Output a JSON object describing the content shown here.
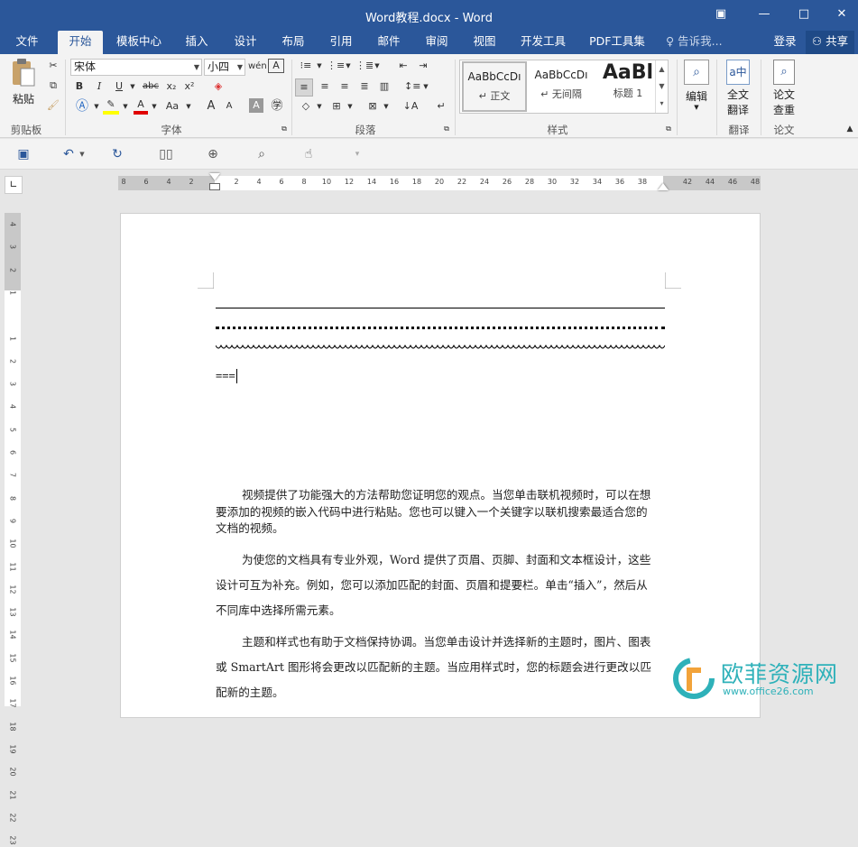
{
  "title": "Word教程.docx - Word",
  "window_buttons": {
    "restore_ribbon": "▣",
    "minimize": "—",
    "maximize": "□",
    "close": "✕"
  },
  "tabs": [
    {
      "label": "文件"
    },
    {
      "label": "开始"
    },
    {
      "label": "模板中心"
    },
    {
      "label": "插入"
    },
    {
      "label": "设计"
    },
    {
      "label": "布局"
    },
    {
      "label": "引用"
    },
    {
      "label": "邮件"
    },
    {
      "label": "审阅"
    },
    {
      "label": "视图"
    },
    {
      "label": "开发工具"
    },
    {
      "label": "PDF工具集"
    }
  ],
  "tell_me": "告诉我...",
  "login": "登录",
  "share": "共享",
  "ribbon": {
    "clipboard": {
      "paste": "粘贴",
      "group": "剪贴板"
    },
    "font": {
      "name": "宋体",
      "size": "小四",
      "group": "字体",
      "bold": "B",
      "italic": "I",
      "underline": "U",
      "strike": "abc",
      "subscript": "x₂",
      "superscript": "x²",
      "grow": "A",
      "shrink": "A",
      "case": "Aa"
    },
    "paragraph": {
      "group": "段落"
    },
    "styles": {
      "group": "样式",
      "items": [
        {
          "preview": "AaBbCcDı",
          "name": "正文"
        },
        {
          "preview": "AaBbCcDı",
          "name": "无间隔"
        },
        {
          "preview": "AaBl",
          "name": "标题 1"
        }
      ]
    },
    "edit": {
      "label": "编辑"
    },
    "translate": {
      "label1": "全文",
      "label2": "翻译",
      "group": "翻译"
    },
    "paper": {
      "label1": "论文",
      "label2": "查重",
      "group": "论文"
    }
  },
  "ruler_h": [
    "8",
    "6",
    "4",
    "2",
    "",
    "2",
    "4",
    "6",
    "8",
    "10",
    "12",
    "14",
    "16",
    "18",
    "20",
    "22",
    "24",
    "26",
    "28",
    "30",
    "32",
    "34",
    "36",
    "38",
    "",
    "42",
    "44",
    "46",
    "48"
  ],
  "ruler_v": [
    "4",
    "3",
    "2",
    "1",
    "",
    "1",
    "2",
    "3",
    "4",
    "5",
    "6",
    "7",
    "8",
    "9",
    "10",
    "11",
    "12",
    "13",
    "14",
    "15",
    "16",
    "17",
    "18",
    "19",
    "20",
    "21",
    "22",
    "23"
  ],
  "document": {
    "typed": "===",
    "paragraphs": [
      "视频提供了功能强大的方法帮助您证明您的观点。当您单击联机视频时，可以在想要添加的视频的嵌入代码中进行粘贴。您也可以键入一个关键字以联机搜索最适合您的文档的视频。",
      "为使您的文档具有专业外观，Word 提供了页眉、页脚、封面和文本框设计，这些设计可互为补充。例如，您可以添加匹配的封面、页眉和提要栏。单击“插入”，然后从不同库中选择所需元素。",
      "主题和样式也有助于文档保持协调。当您单击设计并选择新的主题时，图片、图表或 SmartArt 图形将会更改以匹配新的主题。当应用样式时，您的标题会进行更改以匹配新的主题。"
    ]
  },
  "watermark": {
    "name": "欧菲资源网",
    "url": "www.office26.com"
  },
  "colors": {
    "accent": "#2b579a",
    "highlight": "#ffff00",
    "font_color": "#e00000",
    "watermark": "#2eb1b9"
  }
}
